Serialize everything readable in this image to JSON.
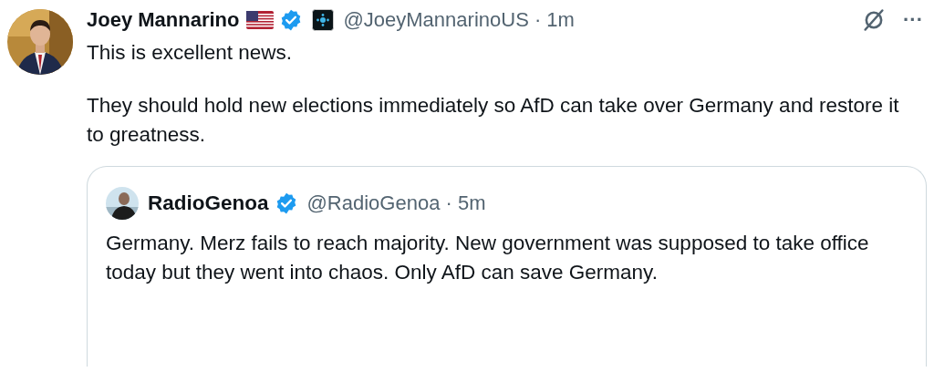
{
  "tweet": {
    "author": {
      "name": "Joey Mannarino",
      "meta": "@JoeyMannarinoUS · 1m"
    },
    "more": "···",
    "paragraphs": [
      "This is excellent news.",
      "They should hold new elections immediately so AfD can take over Germany and restore it to greatness."
    ],
    "quote": {
      "author": {
        "name": "RadioGenoa",
        "meta": "@RadioGenoa · 5m"
      },
      "text": "Germany. Merz fails to reach majority. New government was supposed to take office today but they went into chaos. Only AfD can save Germany."
    }
  }
}
